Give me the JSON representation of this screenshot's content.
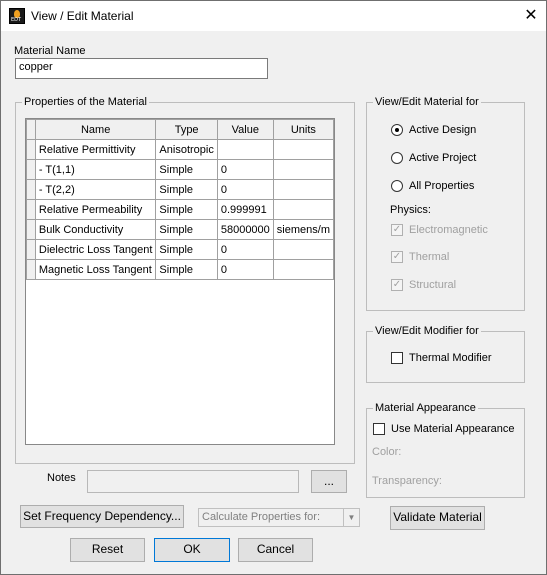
{
  "window": {
    "title": "View / Edit Material",
    "close_glyph": "✕",
    "icon_text": "EDT"
  },
  "material_name": {
    "label": "Material Name",
    "value": "copper"
  },
  "properties": {
    "legend": "Properties of the Material",
    "columns": [
      "Name",
      "Type",
      "Value",
      "Units"
    ],
    "rows": [
      {
        "name": "Relative Permittivity",
        "type": "Anisotropic",
        "value": "",
        "units": ""
      },
      {
        "name": "- T(1,1)",
        "type": "Simple",
        "value": "0",
        "units": ""
      },
      {
        "name": "- T(2,2)",
        "type": "Simple",
        "value": "0",
        "units": ""
      },
      {
        "name": "Relative Permeability",
        "type": "Simple",
        "value": "0.999991",
        "units": ""
      },
      {
        "name": "Bulk Conductivity",
        "type": "Simple",
        "value": "58000000",
        "units": "siemens/m"
      },
      {
        "name": "Dielectric Loss Tangent",
        "type": "Simple",
        "value": "0",
        "units": ""
      },
      {
        "name": "Magnetic Loss Tangent",
        "type": "Simple",
        "value": "0",
        "units": ""
      }
    ]
  },
  "view_edit_for": {
    "legend": "View/Edit Material for",
    "options": [
      {
        "label": "Active Design",
        "selected": true
      },
      {
        "label": "Active Project",
        "selected": false
      },
      {
        "label": "All Properties",
        "selected": false
      }
    ],
    "physics_label": "Physics:",
    "physics": [
      {
        "label": "Electromagnetic",
        "checked": true
      },
      {
        "label": "Thermal",
        "checked": true
      },
      {
        "label": "Structural",
        "checked": true
      }
    ]
  },
  "modifier": {
    "legend": "View/Edit Modifier for",
    "thermal_modifier_label": "Thermal Modifier"
  },
  "appearance": {
    "legend": "Material Appearance",
    "use_label": "Use Material Appearance",
    "color_label": "Color:",
    "transparency_label": "Transparency:"
  },
  "notes": {
    "label": "Notes",
    "value": "",
    "browse_label": "..."
  },
  "buttons": {
    "set_frequency": "Set Frequency Dependency...",
    "calculate_for": "Calculate Properties for:",
    "validate": "Validate Material",
    "reset": "Reset",
    "ok": "OK",
    "cancel": "Cancel"
  }
}
